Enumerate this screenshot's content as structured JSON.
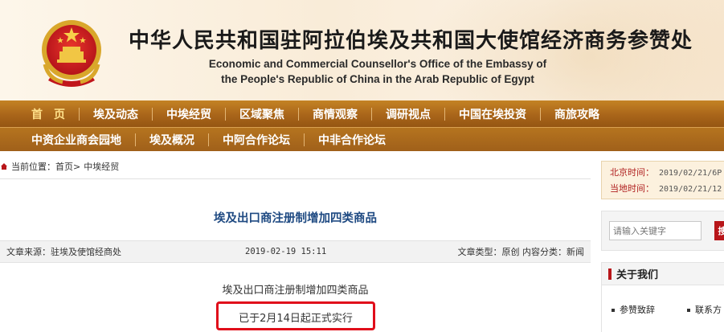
{
  "header": {
    "title_cn": "中华人民共和国驻阿拉伯埃及共和国大使馆经济商务参赞处",
    "title_en_line1": "Economic and Commercial Counsellor's Office of the Embassy of",
    "title_en_line2": "the People's Republic of China in the Arab Republic of Egypt"
  },
  "nav": {
    "row1": [
      "首　页",
      "埃及动态",
      "中埃经贸",
      "区域聚焦",
      "商情观察",
      "调研视点",
      "中国在埃投资",
      "商旅攻略"
    ],
    "row2": [
      "中资企业商会园地",
      "埃及概况",
      "中阿合作论坛",
      "中非合作论坛"
    ]
  },
  "breadcrumb": {
    "label": "当前位置：",
    "home": "首页",
    "sep": ">",
    "current": "中埃经贸"
  },
  "article": {
    "title": "埃及出口商注册制增加四类商品",
    "source": "文章来源：驻埃及使馆经商处",
    "date": "2019-02-19 15:11",
    "type": "文章类型：原创  内容分类：新闻",
    "line1": "埃及出口商注册制增加四类商品",
    "line2": "已于2月14日起正式实行"
  },
  "sidebar": {
    "beijing_label": "北京时间：",
    "beijing_time": "2019/02/21/6P",
    "local_label": "当地时间：",
    "local_time": "2019/02/21/12",
    "search_placeholder": "请输入关键字",
    "search_btn": "搜",
    "about_title": "关于我们",
    "about_link1": "参赞致辞",
    "about_link2": "联系方"
  },
  "colors": {
    "nav_brown": "#a9651a",
    "title_blue": "#1f4a82",
    "highlight_red": "#e00d1a",
    "accent_red": "#b8161a"
  }
}
